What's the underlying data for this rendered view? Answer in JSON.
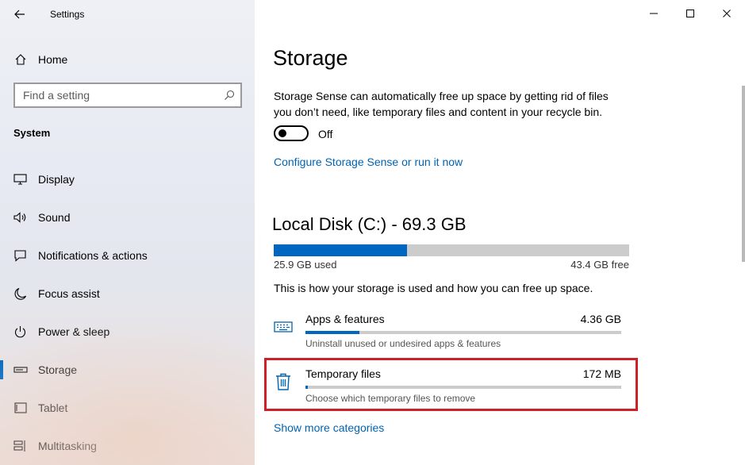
{
  "window": {
    "title": "Settings"
  },
  "sidebar": {
    "home_label": "Home",
    "search_placeholder": "Find a setting",
    "section_title": "System",
    "items": [
      {
        "label": "Display",
        "icon": "display-icon"
      },
      {
        "label": "Sound",
        "icon": "speaker-icon"
      },
      {
        "label": "Notifications & actions",
        "icon": "notification-icon"
      },
      {
        "label": "Focus assist",
        "icon": "moon-icon"
      },
      {
        "label": "Power & sleep",
        "icon": "power-icon"
      },
      {
        "label": "Storage",
        "icon": "storage-icon",
        "selected": true
      },
      {
        "label": "Tablet",
        "icon": "tablet-icon"
      },
      {
        "label": "Multitasking",
        "icon": "multitasking-icon"
      }
    ]
  },
  "main": {
    "title": "Storage",
    "description": "Storage Sense can automatically free up space by getting rid of files you don’t need, like temporary files and content in your recycle bin.",
    "toggle_state": "Off",
    "configure_link": "Configure Storage Sense or run it now",
    "disk": {
      "title": "Local Disk (C:) - 69.3 GB",
      "used_label": "25.9 GB used",
      "free_label": "43.4 GB free",
      "used_fraction": 0.374
    },
    "usage_description": "This is how your storage is used and how you can free up space.",
    "categories": [
      {
        "name": "Apps & features",
        "size": "4.36 GB",
        "hint": "Uninstall unused or undesired apps & features",
        "fraction": 0.17,
        "icon": "keyboard-icon"
      },
      {
        "name": "Temporary files",
        "size": "172 MB",
        "hint": "Choose which temporary files to remove",
        "fraction": 0.008,
        "icon": "trash-icon",
        "highlighted": true
      }
    ],
    "more_link": "Show more categories"
  },
  "colors": {
    "accent": "#0067c0",
    "link": "#0063b1",
    "highlight": "#d02027",
    "bar_track": "#cccccc"
  }
}
